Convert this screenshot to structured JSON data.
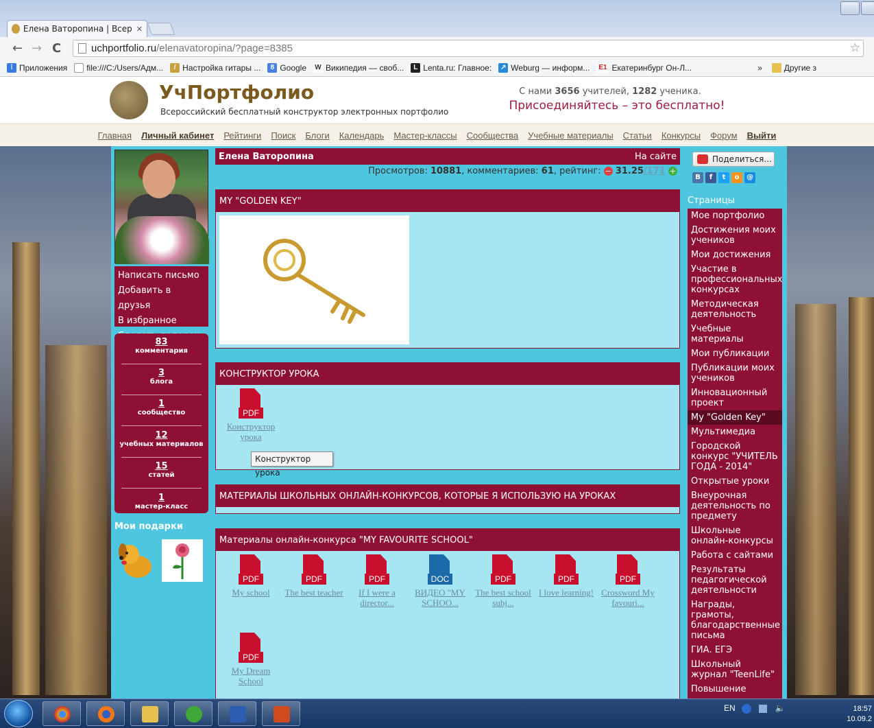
{
  "browser": {
    "tab_title": "Елена Ватоpопина | Всер",
    "url_host": "uchportfolio.ru",
    "url_path": "/elenavatoropina/?page=8385",
    "bookmarks": [
      {
        "icon": "apps-icon",
        "label": "Приложения"
      },
      {
        "icon": "file-icon",
        "label": "file:///C:/Users/Адм..."
      },
      {
        "icon": "guitar-icon",
        "label": "Настройка гитары ..."
      },
      {
        "icon": "google-icon",
        "label": "Google"
      },
      {
        "icon": "wikipedia-icon",
        "label": "Википедия — своб..."
      },
      {
        "icon": "lenta-icon",
        "label": "Lenta.ru: Главное:"
      },
      {
        "icon": "weburg-icon",
        "label": "Weburg — информ..."
      },
      {
        "icon": "e1-icon",
        "label": "Екатеринбург Он-Л..."
      }
    ],
    "more": "»",
    "other_bookmarks": "Другие з"
  },
  "site": {
    "logo_title": "УчПортфолио",
    "logo_sub": "Всероссийский бесплатный конструктор электронных портфолио",
    "stats_prefix": "С нами ",
    "teachers": "3656",
    "stats_mid": " учителей, ",
    "students": "1282",
    "stats_suffix": " ученика.",
    "join": "Присоединяйтесь – это бесплатно!",
    "nav": [
      "Главная",
      "Личный кабинет",
      "Рейтинги",
      "Поиск",
      "Блоги",
      "Календарь",
      "Мастер-классы",
      "Сообщества",
      "Учебные материалы",
      "Статьи",
      "Конкурсы",
      "Форум",
      "Выйти"
    ]
  },
  "profile": {
    "name": "Елена Ватоpопина",
    "status": "На сайте",
    "views_label": "Просмотров: ",
    "views": "10881",
    "comments_label": ", комментариев: ",
    "comments": "61",
    "rating_label": ", рейтинг: ",
    "rating": "31.25",
    "rating_total": "/171",
    "actions": [
      "Написать письмо",
      "Добавить в друзья",
      "В избранное",
      "Сделать подарок"
    ],
    "counters": [
      {
        "n": "83",
        "l": "комментария"
      },
      {
        "n": "3",
        "l": "блога"
      },
      {
        "n": "1",
        "l": "сообщество"
      },
      {
        "n": "12",
        "l": "учебных материалов"
      },
      {
        "n": "15",
        "l": "статей"
      },
      {
        "n": "1",
        "l": "мастер-класс"
      }
    ],
    "gifts_title": "Мои подарки"
  },
  "sections": {
    "golden_key": "MY \"GOLDEN KEY\"",
    "constructor": "КОНСТРУКТОР УРОКА",
    "constructor_file": {
      "type": "PDF",
      "caption": "Конструктор урока"
    },
    "tooltip": "Конструктор урока",
    "materials": "МАТЕРИАЛЫ ШКОЛЬНЫХ ОНЛАЙН-КОНКУРСОВ, КОТОРЫЕ Я ИСПОЛЬЗУЮ НА УРОКАХ",
    "favourite": "Материалы онлайн-конкурса \"MY FAVOURITE SCHOOL\"",
    "favourite_files": [
      {
        "type": "PDF",
        "caption": "My school"
      },
      {
        "type": "PDF",
        "caption": "The best teacher"
      },
      {
        "type": "PDF",
        "caption": "If I were a director..."
      },
      {
        "type": "DOC",
        "caption": "ВИДЕО \"MY SCHOO..."
      },
      {
        "type": "PDF",
        "caption": "The best school subj..."
      },
      {
        "type": "PDF",
        "caption": "I love learning!"
      },
      {
        "type": "PDF",
        "caption": "Crossword My favouri..."
      },
      {
        "type": "PDF",
        "caption": "My Dream School"
      }
    ]
  },
  "sidebar": {
    "share": "Поделиться...",
    "social": [
      {
        "icon": "vk-icon",
        "letter": "B",
        "color": "#4a76a8"
      },
      {
        "icon": "facebook-icon",
        "letter": "f",
        "color": "#3b5998"
      },
      {
        "icon": "twitter-icon",
        "letter": "t",
        "color": "#1da1f2"
      },
      {
        "icon": "odnoklassniki-icon",
        "letter": "o",
        "color": "#f7931e"
      },
      {
        "icon": "mailru-icon",
        "letter": "@",
        "color": "#168de2"
      }
    ],
    "pages_title": "Страницы",
    "pages": [
      "Мое портфолио",
      "Достижения моих учеников",
      "Мои достижения",
      "Участие в профессиональных конкурсах",
      "Методическая деятельность",
      "Учебные материалы",
      "Мои публикации",
      "Публикации моих учеников",
      "Инновационный проект",
      "My \"Golden Key\"",
      "Мультимедиа",
      "Городской конкурс \"УЧИТЕЛЬ ГОДА - 2014\"",
      "Открытые уроки",
      "Внеурочная деятельность по предмету",
      "Школьные онлайн-конкурсы",
      "Работа с сайтами",
      "Результаты педагогической деятельности",
      "Награды, грамоты, благодарственные письма",
      "ГИА. ЕГЭ",
      "Школьный журнал \"TeenLife\"",
      "Повышение"
    ],
    "active_page": "My \"Golden Key\""
  },
  "taskbar": {
    "lang": "EN",
    "time": "18:57",
    "date": "10.09.2"
  }
}
